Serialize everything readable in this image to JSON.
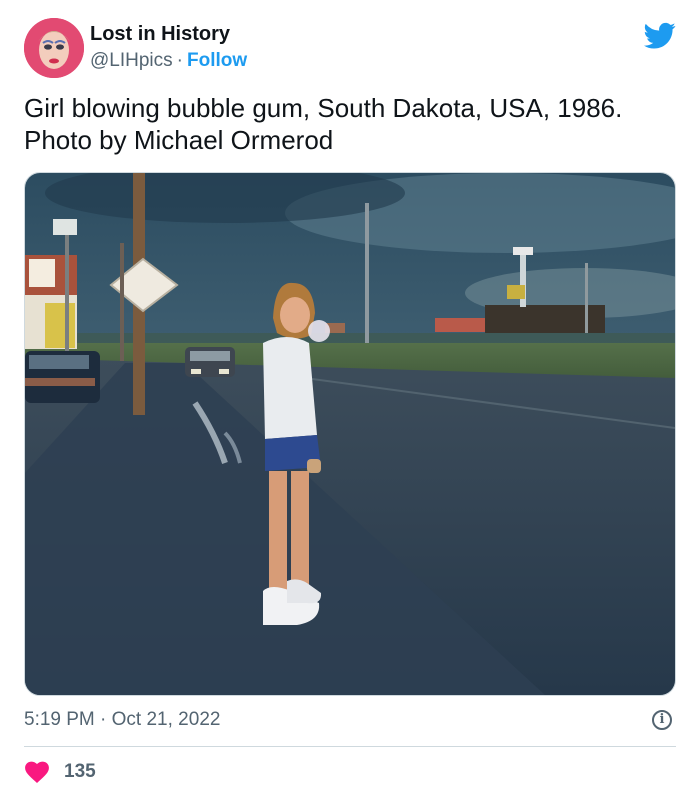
{
  "author": {
    "display_name": "Lost in History",
    "handle": "@LIHpics",
    "separator": "·",
    "follow_label": "Follow"
  },
  "tweet": {
    "text": "Girl blowing bubble gum, South Dakota, USA, 1986. Photo by Michael Ormerod",
    "time": "5:19 PM",
    "separator": "·",
    "date": "Oct 21, 2022"
  },
  "engagement": {
    "likes": "135"
  },
  "icons": {
    "brand": "twitter-bird-icon",
    "info": "info-icon",
    "like": "heart-icon"
  },
  "colors": {
    "accent": "#1d9bf0",
    "like": "#f91880",
    "secondary_text": "#536471"
  }
}
